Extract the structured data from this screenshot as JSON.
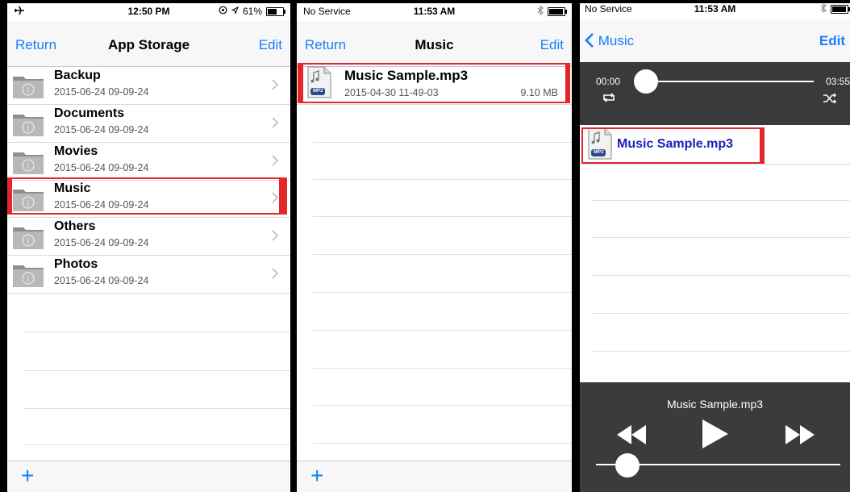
{
  "screen1": {
    "status": {
      "time": "12:50 PM",
      "battery": "61%"
    },
    "nav": {
      "left": "Return",
      "title": "App Storage",
      "right": "Edit"
    },
    "rows": [
      {
        "title": "Backup",
        "date": "2015-06-24 09-09-24"
      },
      {
        "title": "Documents",
        "date": "2015-06-24 09-09-24"
      },
      {
        "title": "Movies",
        "date": "2015-06-24 09-09-24"
      },
      {
        "title": "Music",
        "date": "2015-06-24 09-09-24"
      },
      {
        "title": "Others",
        "date": "2015-06-24 09-09-24"
      },
      {
        "title": "Photos",
        "date": "2015-06-24 09-09-24"
      }
    ],
    "toolbar": {
      "add": "+"
    }
  },
  "screen2": {
    "status": {
      "carrier": "No Service",
      "time": "11:53 AM"
    },
    "nav": {
      "left": "Return",
      "title": "Music",
      "right": "Edit"
    },
    "file": {
      "name": "Music Sample.mp3",
      "date": "2015-04-30 11-49-03",
      "size": "9.10 MB",
      "badge": "MP3"
    },
    "toolbar": {
      "add": "+"
    }
  },
  "screen3": {
    "status": {
      "carrier": "No Service",
      "time": "11:53 AM"
    },
    "nav": {
      "back": "Music",
      "right": "Edit"
    },
    "player": {
      "elapsed": "00:00",
      "total": "03:55",
      "progress": 0.0
    },
    "file": {
      "name": "Music Sample.mp3",
      "badge": "MP3"
    },
    "now_playing": {
      "title": "Music Sample.mp3",
      "volume": 0.13
    }
  },
  "colors": {
    "accent": "#157efb",
    "highlight": "#e3262a",
    "player_bg": "#3a3a3a"
  },
  "icons": [
    "airplane-icon",
    "lock-rotation-icon",
    "location-icon",
    "battery-icon",
    "bluetooth-icon",
    "folder-icon",
    "chevron-right-icon",
    "plus-icon",
    "mp3-file-icon",
    "back-chevron-icon",
    "repeat-icon",
    "shuffle-icon",
    "rewind-icon",
    "play-icon",
    "fast-forward-icon"
  ]
}
